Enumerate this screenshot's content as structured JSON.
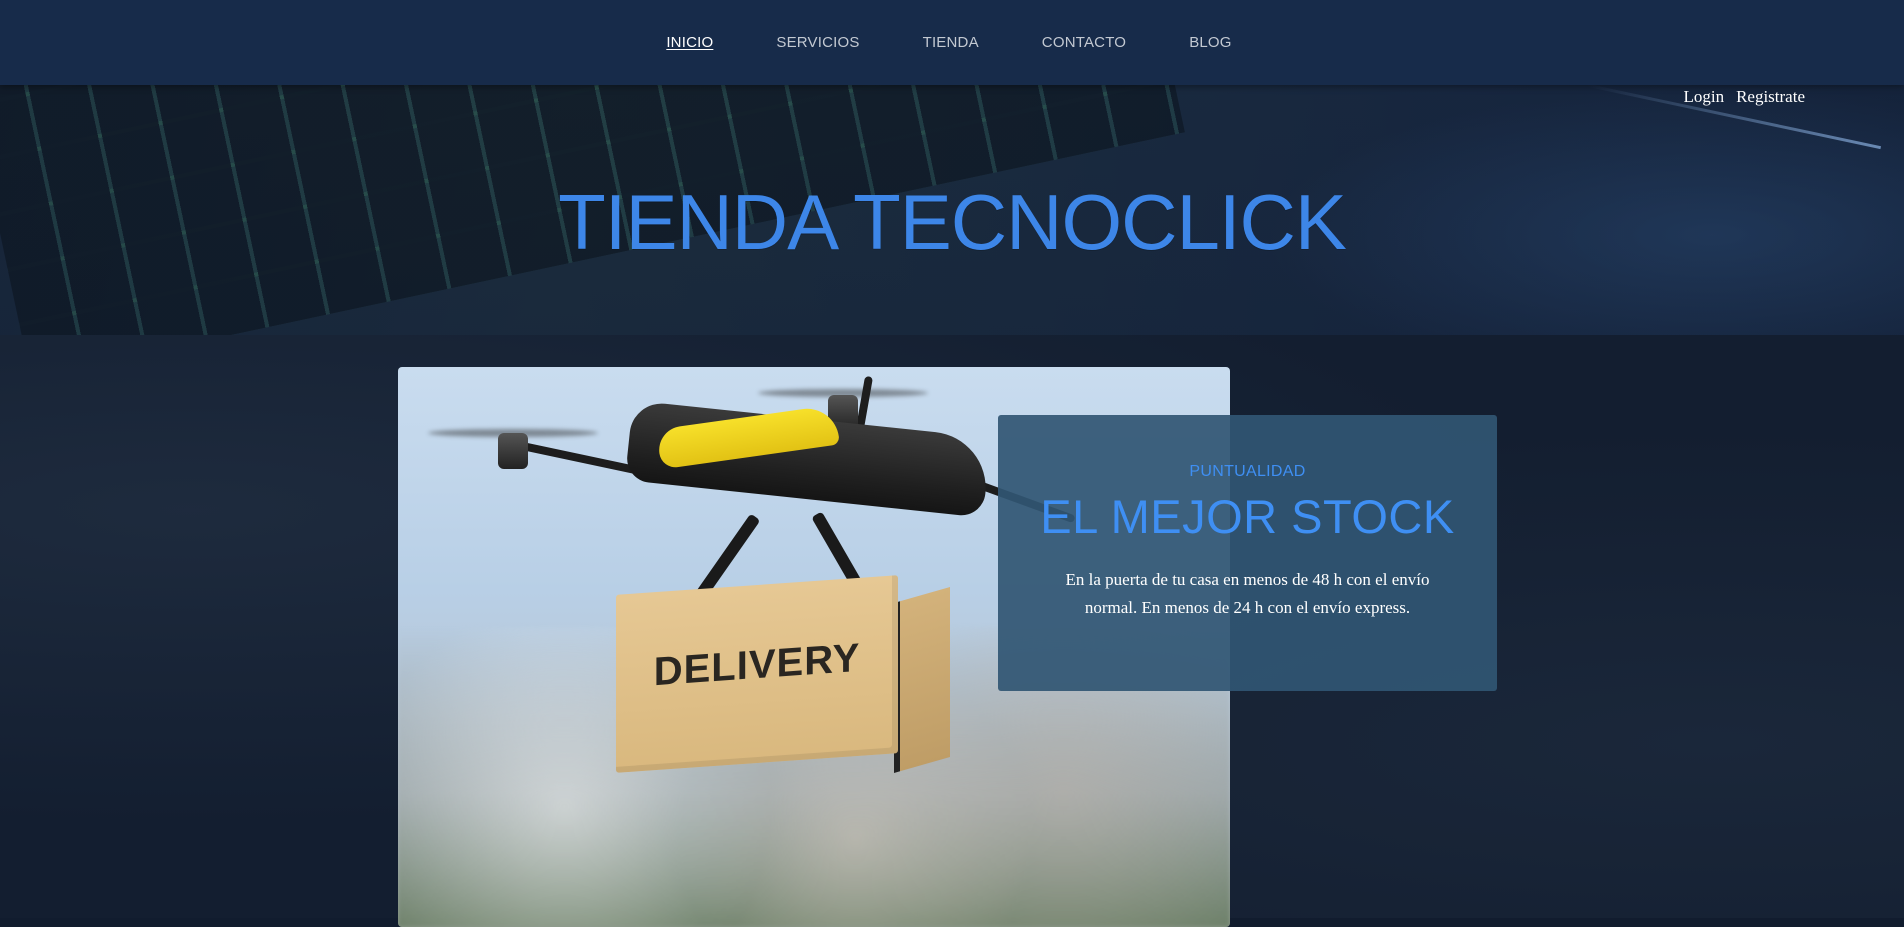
{
  "nav": {
    "items": [
      {
        "label": "INICIO",
        "active": true
      },
      {
        "label": "SERVICIOS",
        "active": false
      },
      {
        "label": "TIENDA",
        "active": false
      },
      {
        "label": "CONTACTO",
        "active": false
      },
      {
        "label": "BLOG",
        "active": false
      }
    ]
  },
  "header": {
    "title": "TIENDA TECNOCLICK",
    "auth": {
      "login": "Login",
      "register": "Registrate"
    }
  },
  "feature": {
    "image_label": "DELIVERY",
    "card": {
      "kicker": "PUNTUALIDAD",
      "title": "EL MEJOR STOCK",
      "text": "En la puerta de tu casa en menos de 48 h con el envío normal. En menos de 24 h con el envío express."
    }
  },
  "colors": {
    "nav_bg": "#172b4a",
    "accent": "#3d86e8",
    "card_bg": "#315673",
    "page_bg": "#131e30"
  }
}
